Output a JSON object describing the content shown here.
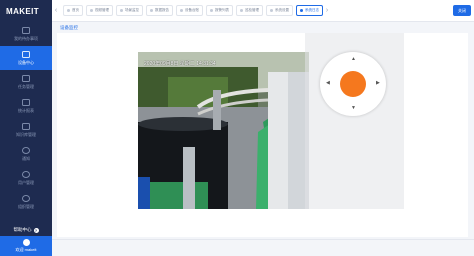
{
  "app": {
    "brand": "MAKEIT"
  },
  "sidebar": {
    "items": [
      {
        "label": "我的待办事项"
      },
      {
        "label": "设备中心"
      },
      {
        "label": "任务管理"
      },
      {
        "label": "统计报表"
      },
      {
        "label": "知识库管理"
      },
      {
        "label": "通知"
      },
      {
        "label": "用户管理"
      },
      {
        "label": "组织管理"
      }
    ],
    "help": "帮助中心",
    "user_label": "欢迎 makeit"
  },
  "tabs": [
    {
      "label": "首页"
    },
    {
      "label": "视频管理"
    },
    {
      "label": "场景监控"
    },
    {
      "label": "数据报告"
    },
    {
      "label": "设备台账"
    },
    {
      "label": "报警列表"
    },
    {
      "label": "巡检管理"
    },
    {
      "label": "系统设置"
    },
    {
      "label": "系统日志"
    }
  ],
  "tabs_more": "关闭",
  "breadcrumb": "设备监控",
  "video": {
    "timestamp": "2020年09月8日 星期二 14:31:34"
  },
  "ptz": {
    "center_color": "#f5781e"
  },
  "colors": {
    "accent": "#1f6be6",
    "sidebar": "#1e2b50"
  }
}
